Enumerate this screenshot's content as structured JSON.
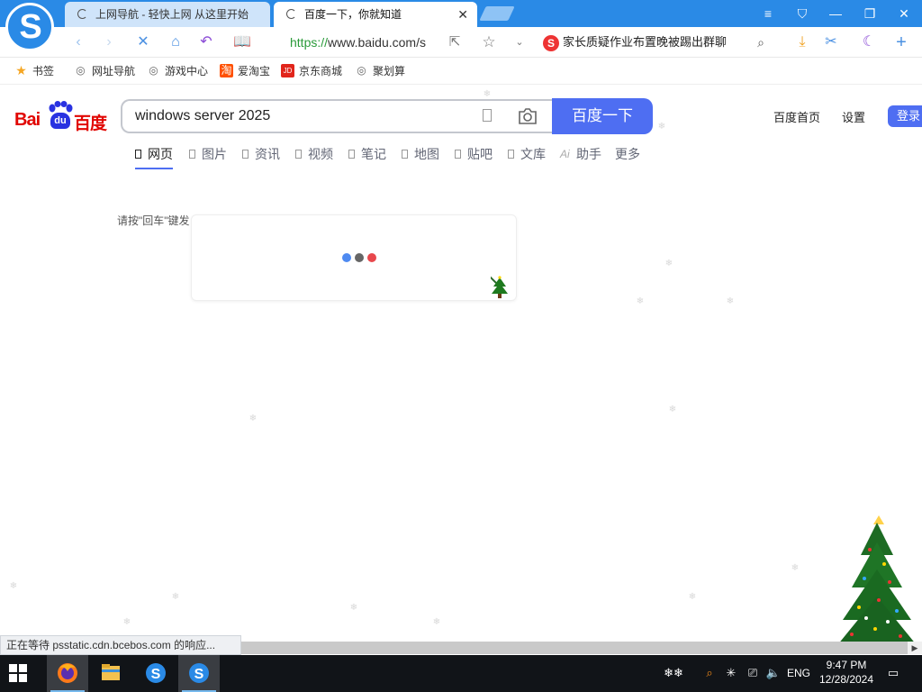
{
  "browser": {
    "tabs": [
      {
        "title": "上网导航 - 轻快上网 从这里开始"
      },
      {
        "title": "百度一下，你就知道"
      }
    ],
    "address": {
      "scheme": "https://",
      "host": "www.baidu.com/s"
    },
    "news_ticker": "家长质疑作业布置晚被踢出群聊",
    "news_badge": "S",
    "bookmarks": [
      {
        "label": "书签",
        "icon": "star-icon",
        "color": "#f5a623"
      },
      {
        "label": "网址导航",
        "icon": "globe-icon"
      },
      {
        "label": "游戏中心",
        "icon": "gamepad-icon"
      },
      {
        "label": "爱淘宝",
        "icon": "taobao-icon",
        "badge": "淘",
        "color": "#ff5000"
      },
      {
        "label": "京东商城",
        "icon": "jd-icon",
        "badge": "JD",
        "color": "#e1251b"
      },
      {
        "label": "聚划算",
        "icon": "juhuasuan-icon"
      }
    ]
  },
  "baidu": {
    "logo_latin": "Bai",
    "logo_du": "du",
    "logo_cn": "百度",
    "query": "windows server 2025",
    "search_button": "百度一下",
    "top_links": [
      "百度首页",
      "设置"
    ],
    "login": "登录",
    "tabs": [
      "网页",
      "图片",
      "资讯",
      "视频",
      "笔记",
      "地图",
      "贴吧",
      "文库",
      "助手",
      "更多"
    ],
    "assistant_badge": "Ai",
    "hint": "请按\"回车\"键发",
    "loading_colors": [
      "#4e8af1",
      "#666666",
      "#e8474c"
    ]
  },
  "status": {
    "text": "正在等待 psstatic.cdn.bcebos.com 的响应..."
  },
  "taskbar": {
    "lang": "ENG",
    "time": "9:47 PM",
    "date": "12/28/2024"
  },
  "colors": {
    "accent": "#4e6ef2",
    "tabbar": "#2a8ae6"
  }
}
